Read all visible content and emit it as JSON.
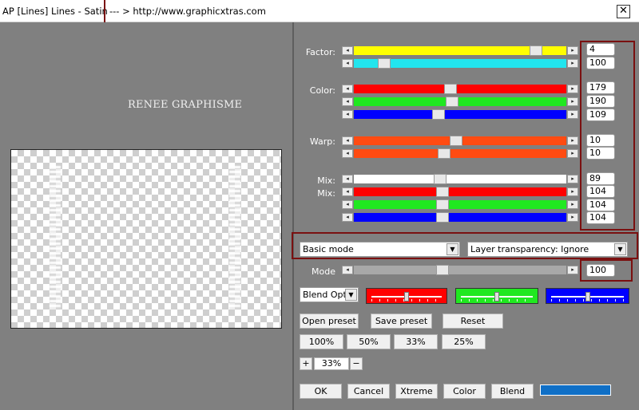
{
  "window": {
    "title": "AP [Lines]  Lines - Satin",
    "url_text": "--- > http://www.graphicxtras.com",
    "close_glyph": "✕"
  },
  "preview": {
    "watermark": "RENEE GRAPHISME"
  },
  "sliders": {
    "factor": {
      "label": "Factor:",
      "rows": [
        {
          "value": "4",
          "color": "#ffff00",
          "fraction": 0.88
        },
        {
          "value": "100",
          "color": "#22e5ee",
          "fraction": 0.12
        }
      ]
    },
    "color": {
      "label": "Color:",
      "rows": [
        {
          "value": "179",
          "color": "#ff0000",
          "fraction": 0.45
        },
        {
          "value": "190",
          "color": "#20e820",
          "fraction": 0.46
        },
        {
          "value": "109",
          "color": "#0000ff",
          "fraction": 0.39
        }
      ]
    },
    "warp": {
      "label": "Warp:",
      "rows": [
        {
          "value": "10",
          "color": "#ff4b12",
          "fraction": 0.48
        },
        {
          "value": "10",
          "color": "#ff4b12",
          "fraction": 0.42
        }
      ]
    },
    "mix": {
      "label1": "Mix:",
      "label2": "Mix:",
      "rows": [
        {
          "value": "89",
          "color": "#ffffff",
          "fraction": 0.4
        },
        {
          "value": "104",
          "color": "#ff0000",
          "fraction": 0.41
        },
        {
          "value": "104",
          "color": "#20e820",
          "fraction": 0.41
        },
        {
          "value": "104",
          "color": "#0000ff",
          "fraction": 0.41
        }
      ]
    }
  },
  "mode_select": {
    "value": "Basic mode",
    "arrow": "▼"
  },
  "transparency_select": {
    "value": "Layer transparency: Ignore",
    "arrow": "▼"
  },
  "mode_slider": {
    "label": "Mode",
    "value": "100",
    "color": "#a8a8a8",
    "fraction": 0.41
  },
  "blend_select": {
    "value": "Blend Optio",
    "arrow": "▼"
  },
  "color_sliders": [
    {
      "color": "#ff0000",
      "fraction": 0.5
    },
    {
      "color": "#20e820",
      "fraction": 0.5
    },
    {
      "color": "#0000ff",
      "fraction": 0.5
    }
  ],
  "preset_buttons": {
    "open": "Open preset",
    "save": "Save preset",
    "reset": "Reset"
  },
  "zoom_buttons": [
    "100%",
    "50%",
    "33%",
    "25%"
  ],
  "zoom": {
    "plus": "+",
    "value": "33%",
    "minus": "−"
  },
  "bottom_buttons": {
    "ok": "OK",
    "cancel": "Cancel",
    "xtreme": "Xtreme",
    "color": "Color",
    "blend": "Blend"
  },
  "blend_color": "#0f6fc6"
}
